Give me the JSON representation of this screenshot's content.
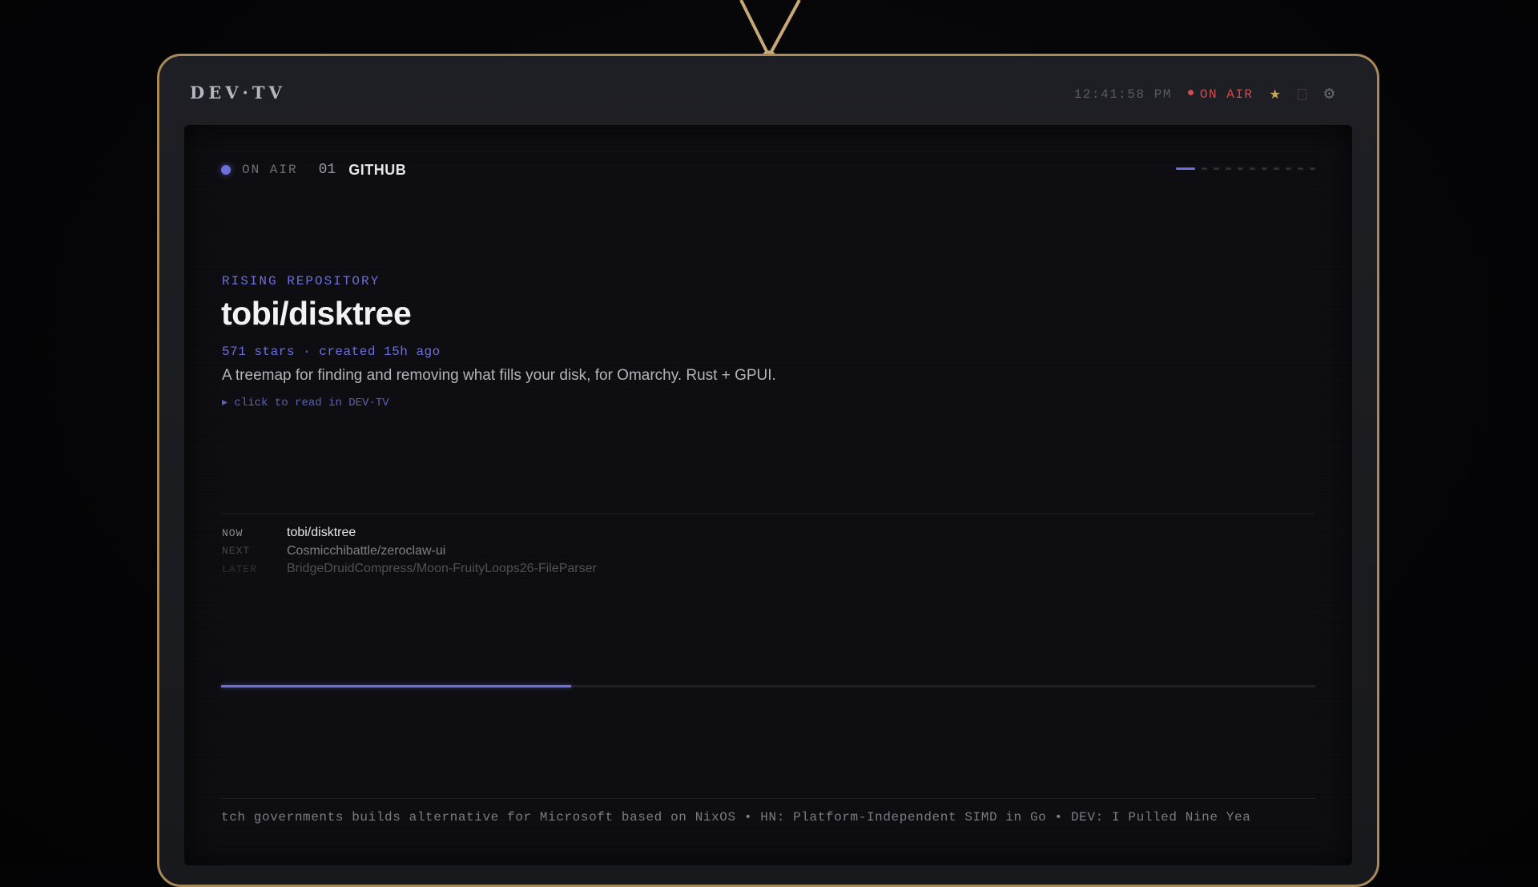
{
  "window": {
    "title": "DEV·TV"
  },
  "header": {
    "clock": "12:41:58 PM",
    "on_air": "ON AIR",
    "icons": [
      "star-icon",
      "square-icon",
      "gear-icon"
    ]
  },
  "channel": {
    "status": "ON AIR",
    "number": "01",
    "name": "GITHUB",
    "page_count": 11,
    "active_page": 1
  },
  "story": {
    "eyebrow": "RISING REPOSITORY",
    "title": "tobi/disktree",
    "meta": "571 stars · created 15h ago",
    "description": "A treemap for finding and removing what fills your disk, for Omarchy. Rust + GPUI.",
    "read_link": "▸ click to read in DEV·TV"
  },
  "schedule": [
    {
      "slot": "NOW",
      "item": "tobi/disktree"
    },
    {
      "slot": "NEXT",
      "item": "Cosmicchibattle/zeroclaw-ui"
    },
    {
      "slot": "LATER",
      "item": "BridgeDruidCompress/Moon-FruityLoops26-FileParser"
    }
  ],
  "progress": 0.32,
  "ticker": "tch governments builds alternative for Microsoft based on NixOS • HN: Platform-Independent SIMD in Go • DEV: I Pulled Nine Yea",
  "colors": {
    "accent": "#6b6fdc",
    "bezel": "#a88a5a",
    "on_air": "#d44b4b",
    "star": "#c9a55a"
  }
}
